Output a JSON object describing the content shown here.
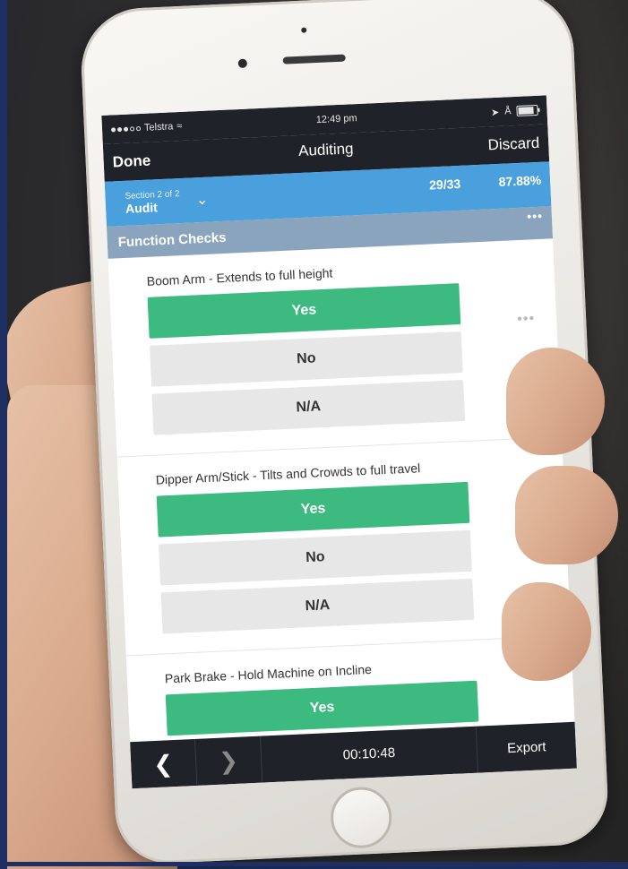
{
  "status_bar": {
    "carrier": "Telstra",
    "time": "12:49 pm"
  },
  "nav": {
    "done_label": "Done",
    "title": "Auditing",
    "discard_label": "Discard"
  },
  "section": {
    "subtitle": "Section 2 of 2",
    "name": "Audit",
    "progress": "29/33",
    "percent": "87.88%"
  },
  "group": {
    "title": "Function Checks",
    "more": "•••"
  },
  "questions": [
    {
      "text": "Boom Arm - Extends to full height",
      "options": [
        "Yes",
        "No",
        "N/A"
      ],
      "selected": "Yes"
    },
    {
      "text": "Dipper Arm/Stick - Tilts and Crowds to full travel",
      "options": [
        "Yes",
        "No",
        "N/A"
      ],
      "selected": "Yes"
    },
    {
      "text": "Park Brake - Hold Machine on Incline",
      "options": [
        "Yes"
      ],
      "selected": "Yes"
    }
  ],
  "question_more": "•••",
  "toolbar": {
    "back_icon": "chevron-left-icon",
    "forward_icon": "chevron-right-icon",
    "timer": "00:10:48",
    "export_label": "Export"
  },
  "colors": {
    "selected_green": "#3dba80",
    "section_blue": "#4aa0dd",
    "group_grey_blue": "#8aa4bd",
    "dark_bar": "#1f2228"
  }
}
